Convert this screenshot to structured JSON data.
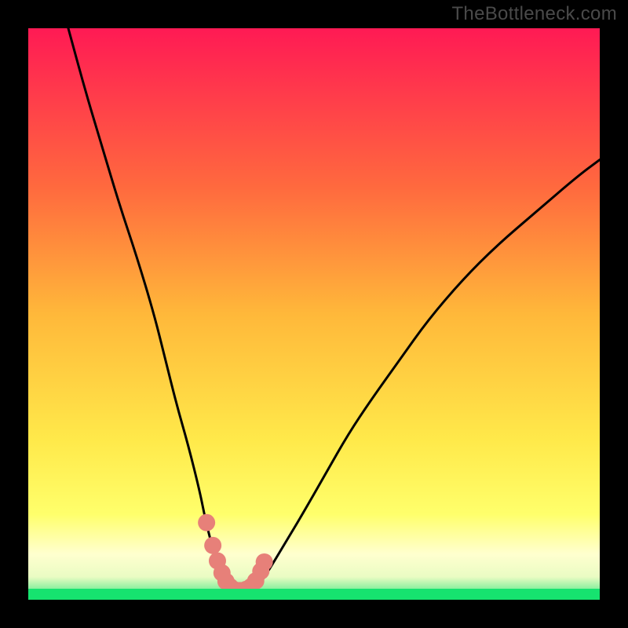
{
  "watermark": "TheBottleneck.com",
  "colors": {
    "bg_black": "#000000",
    "gradient_top": "#ff1a54",
    "gradient_mid": "#ffb83a",
    "gradient_low": "#ffff63",
    "gradient_pale": "#ffffd1",
    "gradient_green": "#16e36f",
    "curve": "#000000",
    "marker": "#e78079"
  },
  "chart_data": {
    "type": "line",
    "title": "",
    "xlabel": "",
    "ylabel": "",
    "xlim": [
      0,
      100
    ],
    "ylim": [
      0,
      100
    ],
    "series": [
      {
        "name": "left-branch",
        "x": [
          7,
          10,
          13,
          16,
          19,
          22,
          24,
          26,
          28,
          30,
          31,
          32,
          33,
          34,
          35
        ],
        "y": [
          100,
          89,
          79,
          69,
          60,
          50,
          42,
          34,
          27,
          19,
          14,
          10,
          7,
          4,
          2
        ]
      },
      {
        "name": "valley",
        "x": [
          35,
          36,
          37,
          38,
          39,
          40
        ],
        "y": [
          2,
          1,
          1,
          1,
          1,
          2
        ]
      },
      {
        "name": "right-branch",
        "x": [
          40,
          42,
          45,
          48,
          52,
          56,
          60,
          65,
          70,
          76,
          82,
          89,
          96,
          100
        ],
        "y": [
          2,
          5,
          10,
          15,
          22,
          29,
          35,
          42,
          49,
          56,
          62,
          68,
          74,
          77
        ]
      }
    ],
    "markers": {
      "name": "highlight-points",
      "x": [
        31.2,
        32.3,
        33.1,
        33.9,
        34.6,
        35.3,
        36.2,
        37.1,
        38.1,
        39.0,
        39.8,
        40.7,
        41.3
      ],
      "y": [
        13.5,
        9.5,
        6.8,
        4.7,
        3.2,
        2.3,
        1.7,
        1.6,
        1.8,
        2.3,
        3.3,
        5.0,
        6.6
      ]
    },
    "gradient_bands": [
      {
        "y": 100,
        "color": "#ff1a54"
      },
      {
        "y": 50,
        "color": "#ffb83a"
      },
      {
        "y": 20,
        "color": "#ffff63"
      },
      {
        "y": 8,
        "color": "#ffffd1"
      },
      {
        "y": 2,
        "color": "#16e36f"
      }
    ]
  }
}
